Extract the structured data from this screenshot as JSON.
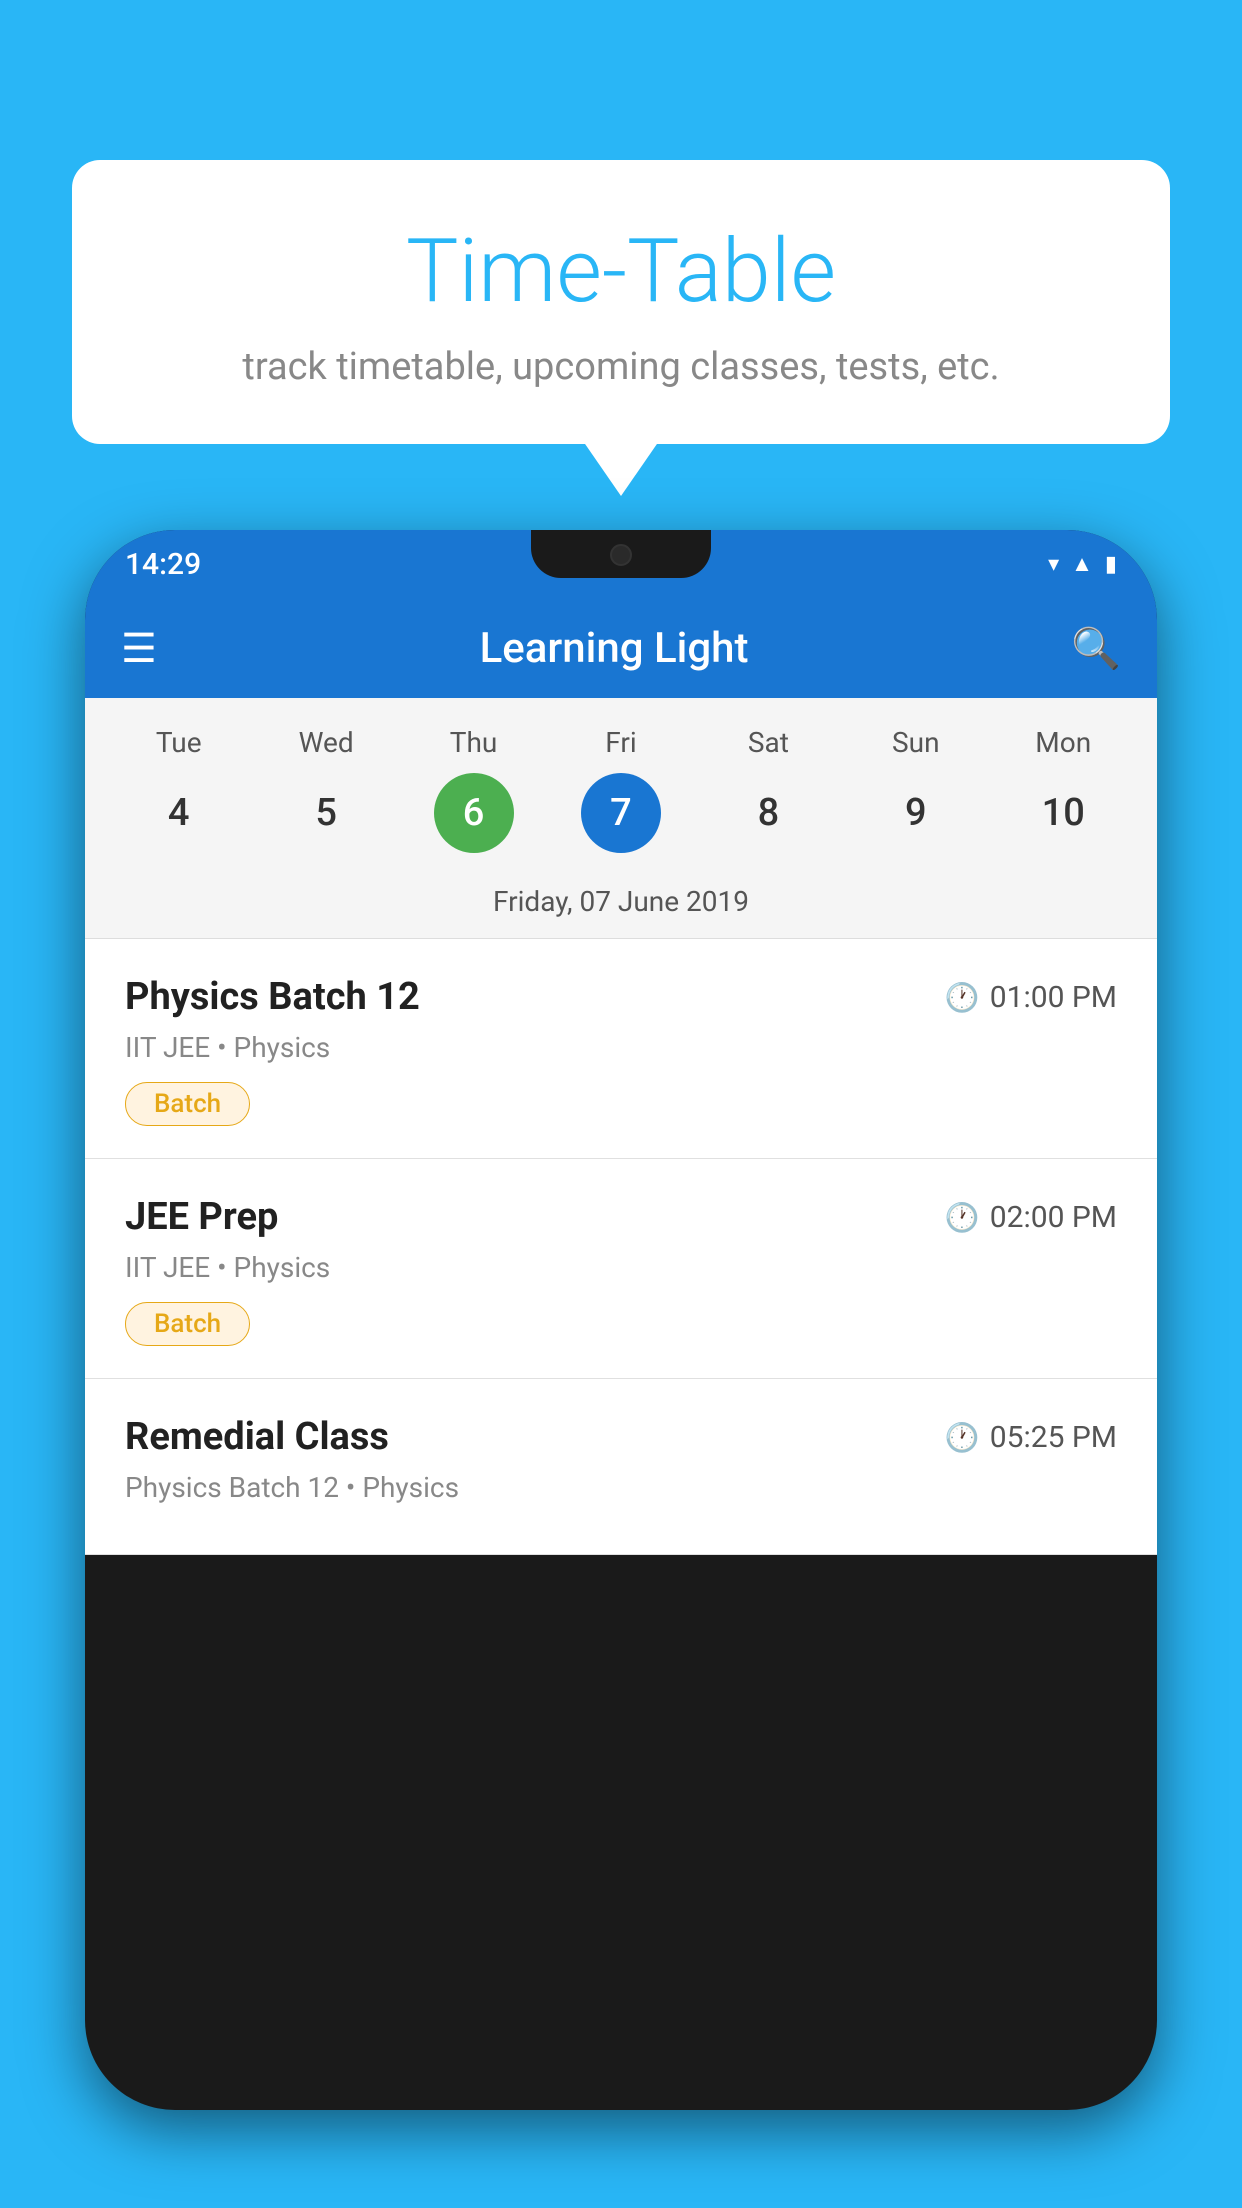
{
  "background_color": "#29b6f6",
  "speech_bubble": {
    "title": "Time-Table",
    "subtitle": "track timetable, upcoming classes, tests, etc."
  },
  "phone": {
    "status_bar": {
      "time": "14:29"
    },
    "app_bar": {
      "title": "Learning Light"
    },
    "calendar": {
      "days": [
        "Tue",
        "Wed",
        "Thu",
        "Fri",
        "Sat",
        "Sun",
        "Mon"
      ],
      "dates": [
        "4",
        "5",
        "6",
        "7",
        "8",
        "9",
        "10"
      ],
      "today_index": 2,
      "selected_index": 3,
      "selected_label": "Friday, 07 June 2019"
    },
    "classes": [
      {
        "name": "Physics Batch 12",
        "time": "01:00 PM",
        "subtitle": "IIT JEE • Physics",
        "badge": "Batch"
      },
      {
        "name": "JEE Prep",
        "time": "02:00 PM",
        "subtitle": "IIT JEE • Physics",
        "badge": "Batch"
      },
      {
        "name": "Remedial Class",
        "time": "05:25 PM",
        "subtitle": "Physics Batch 12 • Physics",
        "badge": null
      }
    ]
  }
}
